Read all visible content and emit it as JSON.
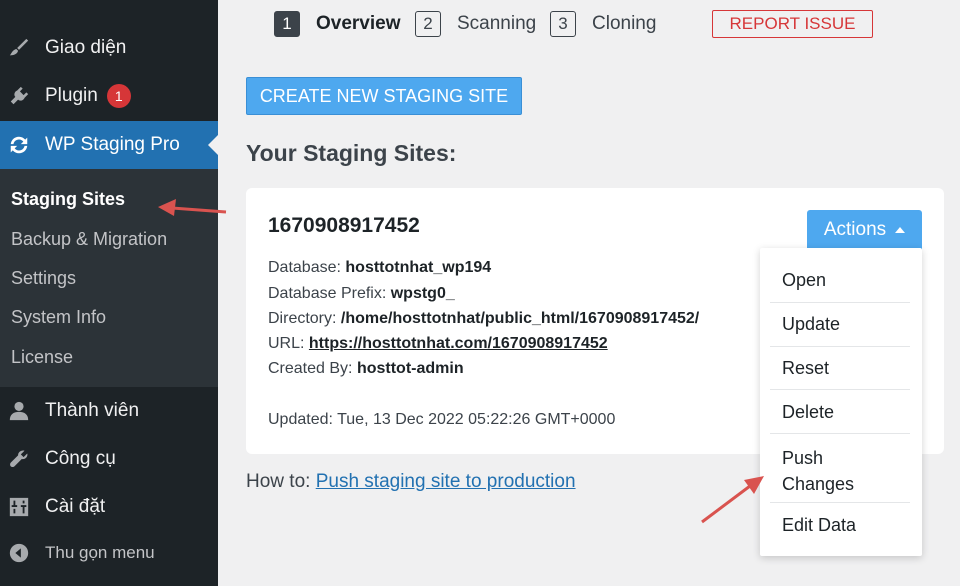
{
  "sidebar": {
    "items": [
      {
        "label": "Giao diện",
        "icon": "paintbrush-icon"
      },
      {
        "label": "Plugin",
        "icon": "plugin-icon",
        "badge": "1"
      },
      {
        "label": "WP Staging Pro",
        "icon": "sync-icon",
        "active": true
      },
      {
        "label": "Thành viên",
        "icon": "user-icon"
      },
      {
        "label": "Công cụ",
        "icon": "wrench-icon"
      },
      {
        "label": "Cài đặt",
        "icon": "settings-sliders-icon"
      },
      {
        "label": "Thu gọn menu",
        "icon": "collapse-icon"
      }
    ],
    "submenu": [
      "Staging Sites",
      "Backup & Migration",
      "Settings",
      "System Info",
      "License"
    ]
  },
  "steps": [
    {
      "num": "1",
      "label": "Overview"
    },
    {
      "num": "2",
      "label": "Scanning"
    },
    {
      "num": "3",
      "label": "Cloning"
    }
  ],
  "report_label": "REPORT ISSUE",
  "create_label": "CREATE NEW STAGING SITE",
  "section_title": "Your Staging Sites:",
  "site": {
    "name": "1670908917452",
    "database_label": "Database:",
    "database": "hosttotnhat_wp194",
    "prefix_label": "Database Prefix:",
    "prefix": "wpstg0_",
    "directory_label": "Directory:",
    "directory": "/home/hosttotnhat/public_html/1670908917452/",
    "url_label": "URL:",
    "url": "https://hosttotnhat.com/1670908917452",
    "created_label": "Created By:",
    "created_by": "hosttot-admin",
    "updated": "Updated: Tue, 13 Dec 2022 05:22:26 GMT+0000"
  },
  "actions_label": "Actions",
  "dropdown": [
    "Open",
    "Update",
    "Reset",
    "Delete",
    "Push",
    "Changes",
    "Edit Data"
  ],
  "howto": {
    "prefix": "How to:",
    "link": "Push staging site to production"
  },
  "colors": {
    "sidebar": "#1d2327",
    "active": "#2271b1",
    "button": "#4ea8ef",
    "danger": "#d63638"
  }
}
